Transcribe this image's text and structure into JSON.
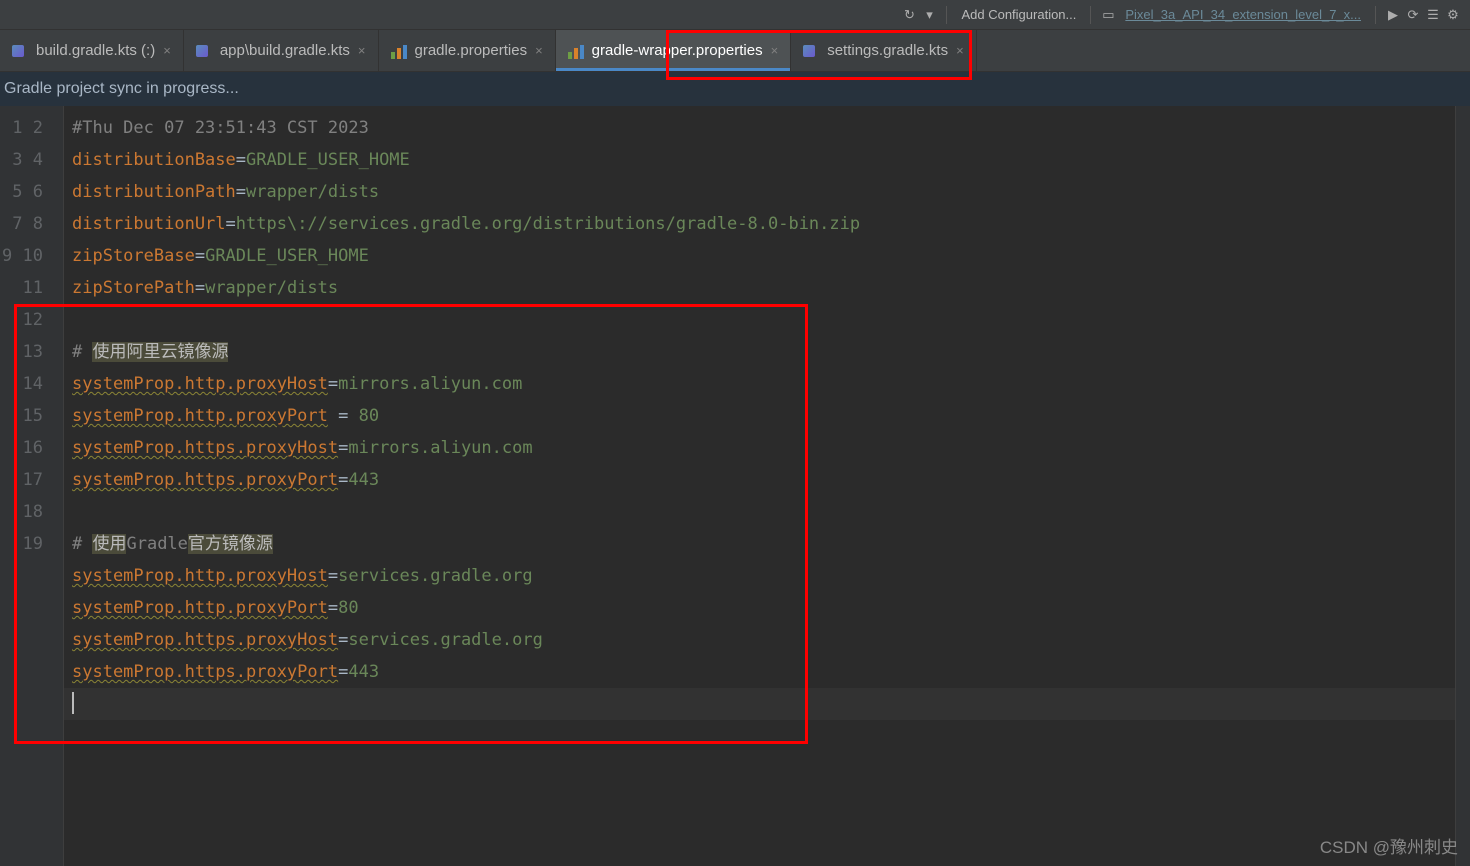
{
  "toolbar": {
    "addConfig": "Add Configuration...",
    "device": "Pixel_3a_API_34_extension_level_7_x..."
  },
  "tabs": [
    {
      "icon": "kts",
      "label": "build.gradle.kts (:)",
      "active": false
    },
    {
      "icon": "kts",
      "label": "app\\build.gradle.kts",
      "active": false
    },
    {
      "icon": "gradle",
      "label": "gradle.properties",
      "active": false
    },
    {
      "icon": "gradle",
      "label": "gradle-wrapper.properties",
      "active": true
    },
    {
      "icon": "kts",
      "label": "settings.gradle.kts",
      "active": false
    }
  ],
  "syncMessage": "Gradle project sync in progress...",
  "gutterStart": 1,
  "gutterEnd": 19,
  "caretLine": 19,
  "code": [
    {
      "type": "comment",
      "text": "#Thu Dec 07 23:51:43 CST 2023"
    },
    {
      "type": "prop",
      "key": "distributionBase",
      "eq": "=",
      "val": "GRADLE_USER_HOME"
    },
    {
      "type": "prop",
      "key": "distributionPath",
      "eq": "=",
      "val": "wrapper/dists"
    },
    {
      "type": "prop",
      "key": "distributionUrl",
      "eq": "=",
      "val": "https\\://services.gradle.org/distributions/gradle-8.0-bin.zip"
    },
    {
      "type": "prop",
      "key": "zipStoreBase",
      "eq": "=",
      "val": "GRADLE_USER_HOME"
    },
    {
      "type": "prop",
      "key": "zipStorePath",
      "eq": "=",
      "val": "wrapper/dists"
    },
    {
      "type": "blank"
    },
    {
      "type": "commenthl",
      "prefix": "# ",
      "hl": "使用阿里云镜像源"
    },
    {
      "type": "propwarn",
      "key": "systemProp.http.proxyHost",
      "eq": "=",
      "val": "mirrors.aliyun.com"
    },
    {
      "type": "propwarn",
      "key": "systemProp.http.proxyPort",
      "eq": " = ",
      "val": "80"
    },
    {
      "type": "propwarn",
      "key": "systemProp.https.proxyHost",
      "eq": "=",
      "val": "mirrors.aliyun.com"
    },
    {
      "type": "propwarn",
      "key": "systemProp.https.proxyPort",
      "eq": "=",
      "val": "443"
    },
    {
      "type": "blank"
    },
    {
      "type": "commenthl2",
      "prefix": "# ",
      "hl1": "使用",
      "mid": "Gradle",
      "hl2": "官方镜像源"
    },
    {
      "type": "propwarn",
      "key": "systemProp.http.proxyHost",
      "eq": "=",
      "val": "services.gradle.org"
    },
    {
      "type": "propwarn",
      "key": "systemProp.http.proxyPort",
      "eq": "=",
      "val": "80"
    },
    {
      "type": "propwarn",
      "key": "systemProp.https.proxyHost",
      "eq": "=",
      "val": "services.gradle.org"
    },
    {
      "type": "propwarn",
      "key": "systemProp.https.proxyPort",
      "eq": "=",
      "val": "443"
    },
    {
      "type": "blank"
    }
  ],
  "watermark": "CSDN @豫州刺史"
}
